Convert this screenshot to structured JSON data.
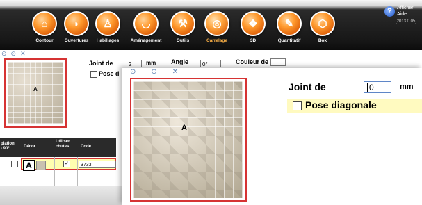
{
  "toolbar": {
    "items": [
      {
        "label": "Contour",
        "icon": "contour-icon",
        "glyph": "⌂",
        "active": false
      },
      {
        "label": "Ouvertures",
        "icon": "door-icon",
        "glyph": "◗",
        "active": false
      },
      {
        "label": "Habillages",
        "icon": "shirt-icon",
        "glyph": "♙",
        "active": false
      },
      {
        "label": "Aménagement",
        "icon": "bathtub-icon",
        "glyph": "◡",
        "active": false
      },
      {
        "label": "Outils",
        "icon": "hammer-icon",
        "glyph": "⚒",
        "active": false
      },
      {
        "label": "Carrelage",
        "icon": "tile-icon",
        "glyph": "◎",
        "active": true
      },
      {
        "label": "3D",
        "icon": "3d-icon",
        "glyph": "❖",
        "active": false
      },
      {
        "label": "Quantitatif",
        "icon": "quantity-icon",
        "glyph": "✎",
        "active": false
      },
      {
        "label": "Box",
        "icon": "box-icon",
        "glyph": "⬡",
        "active": false
      }
    ],
    "help": {
      "line1": "Afficher",
      "line2": "Aide",
      "version": "[2013.0.05]"
    }
  },
  "background_panel": {
    "joint_label": "Joint de",
    "joint_value": "2",
    "joint_unit": "mm",
    "angle_label": "Angle",
    "angle_value": "0°",
    "couleur_label": "Couleur de",
    "pose_label": "Pose d",
    "thumb_letter": "A",
    "table": {
      "headers": [
        "plation\n- 90°",
        "Décor",
        "Utiliser\nchutes",
        "Code"
      ],
      "row": {
        "letter": "A",
        "code": "3733",
        "utiliser_chutes": true
      }
    }
  },
  "overlay": {
    "joint_label": "Joint de",
    "joint_value": "0",
    "joint_unit": "mm",
    "pose_label": "Pose diagonale",
    "thumb_letter": "A"
  },
  "colors": {
    "accent_orange": "#ff9a2e",
    "selection_red": "#d63333",
    "highlight_yellow": "#fffac0",
    "toolbar_dark": "#161616"
  }
}
